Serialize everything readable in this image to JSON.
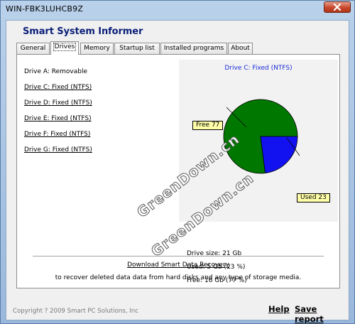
{
  "window": {
    "title": "WIN-FBK3LUHCB9Z"
  },
  "app": {
    "title": "Smart System Informer"
  },
  "tabs": [
    {
      "label": "General"
    },
    {
      "label": "Drives"
    },
    {
      "label": "Memory"
    },
    {
      "label": "Startup list"
    },
    {
      "label": "Installed programs"
    },
    {
      "label": "About"
    }
  ],
  "active_tab": "Drives",
  "drives": [
    {
      "label": "Drive A: Removable"
    },
    {
      "label": "Drive C: Fixed (NTFS)"
    },
    {
      "label": "Drive D: Fixed (NTFS)"
    },
    {
      "label": "Drive E: Fixed (NTFS)"
    },
    {
      "label": "Drive F: Fixed (NTFS)"
    },
    {
      "label": "Drive G: Fixed (NTFS)"
    }
  ],
  "chart": {
    "title": "Drive C: Fixed (NTFS)",
    "free_label": "Free 77",
    "used_label": "Used 23"
  },
  "chart_data": {
    "type": "pie",
    "title": "Drive C: Fixed (NTFS)",
    "slices": [
      {
        "name": "Free",
        "value": 77,
        "color": "#007800"
      },
      {
        "name": "Used",
        "value": 23,
        "color": "#1212f0"
      }
    ]
  },
  "watermark": {
    "text1": "GreenDown.cn",
    "text2": "GreenDown.cn"
  },
  "info": {
    "size": "Drive size: 21 Gb",
    "used": "Used: 5 Gb (23 %)",
    "free": "Free: 16 Gb (77 %)"
  },
  "footer": {
    "download_link": "Download Smart Data Recovery",
    "recover_text": "to recover deleted data data from hard disks and any type of storage media.",
    "copyright": "Copyright ? 2009 Smart PC Solutions, Inc",
    "help": "Help",
    "save_report": "Save report"
  },
  "colors": {
    "title_blue": "#0a1f78",
    "chart_title_blue": "#1a2bd8",
    "free_green": "#007800",
    "used_blue": "#1212f0",
    "label_bg": "#ffffa8"
  }
}
